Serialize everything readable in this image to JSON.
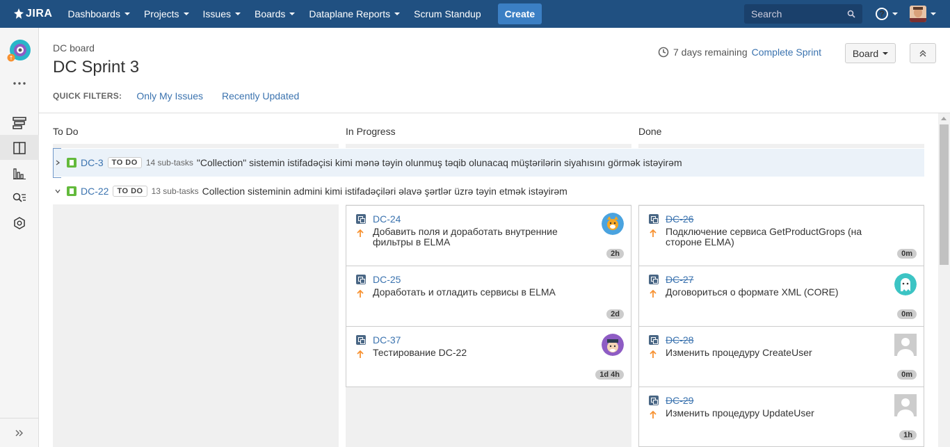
{
  "topnav": {
    "logo_text": "JIRA",
    "items": [
      "Dashboards",
      "Projects",
      "Issues",
      "Boards",
      "Dataplane Reports"
    ],
    "standup": "Scrum Standup",
    "create_label": "Create",
    "search_placeholder": "Search",
    "help_icon": "?"
  },
  "header": {
    "board_name": "DC board",
    "sprint_title": "DC Sprint 3",
    "days_remaining": "7 days remaining",
    "complete_sprint": "Complete Sprint",
    "board_button": "Board"
  },
  "quick_filters": {
    "label": "QUICK FILTERS:",
    "items": [
      "Only My Issues",
      "Recently Updated"
    ]
  },
  "columns": [
    "To Do",
    "In Progress",
    "Done"
  ],
  "swimlanes": [
    {
      "key": "DC-3",
      "status": "TO DO",
      "subtasks": "14 sub-tasks",
      "summary": "\"Collection\" sistemin istifadəçisi kimi mənə təyin olunmuş təqib olunacaq müştərilərin siyahısını görmək istəyirəm"
    },
    {
      "key": "DC-22",
      "status": "TO DO",
      "subtasks": "13 sub-tasks",
      "summary": "Collection sisteminin admini kimi istifadəçiləri əlavə şərtlər üzrə təyin etmək istəyirəm"
    }
  ],
  "cards": {
    "in_progress": [
      {
        "key": "DC-24",
        "summary": "Добавить поля и доработать внутренние фильтры в ELMA",
        "estimate": "2h",
        "avatar": "cat-avatar"
      },
      {
        "key": "DC-25",
        "summary": "Доработать и отладить сервисы в ELMA",
        "estimate": "2d",
        "avatar": ""
      },
      {
        "key": "DC-37",
        "summary": "Тестирование DC-22",
        "estimate": "1d 4h",
        "avatar": "hat-avatar"
      }
    ],
    "done": [
      {
        "key": "DC-26",
        "summary": "Подключение сервиса GetProductGrops (на стороне ELMA)",
        "estimate": "0m",
        "avatar": ""
      },
      {
        "key": "DC-27",
        "summary": "Договориться о формате XML (CORE)",
        "estimate": "0m",
        "avatar": "ghost-avatar"
      },
      {
        "key": "DC-28",
        "summary": "Изменить процедуру CreateUser",
        "estimate": "0m",
        "avatar": "default-avatar"
      },
      {
        "key": "DC-29",
        "summary": "Изменить процедуру UpdateUser",
        "estimate": "1h",
        "avatar": "default-avatar"
      }
    ]
  },
  "colors": {
    "nav": "#205081",
    "link": "#3b73af",
    "story": "#63ba3c",
    "priority": "#f79232"
  }
}
